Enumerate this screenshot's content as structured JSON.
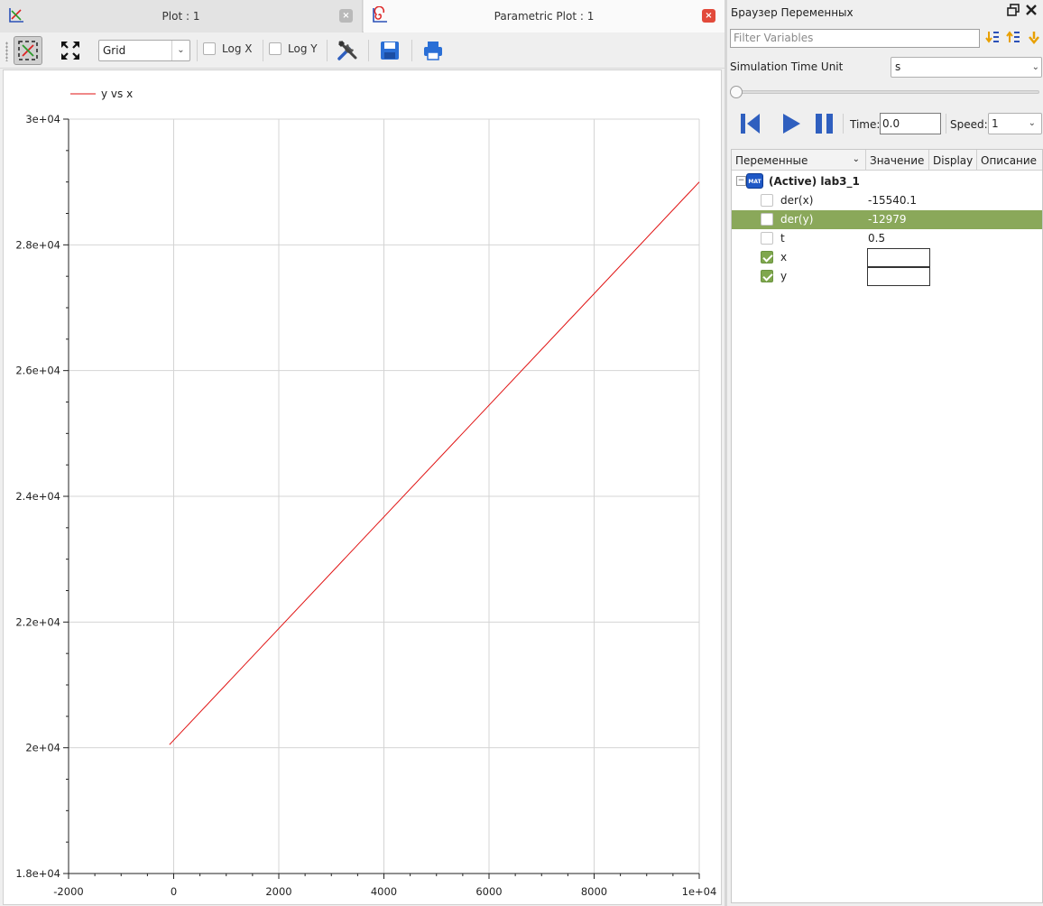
{
  "tabs": [
    {
      "title": "Plot : 1",
      "close": "×"
    },
    {
      "title": "Parametric Plot : 1",
      "close": "×"
    }
  ],
  "toolbar": {
    "grid_select": "Grid",
    "log_x": "Log X",
    "log_y": "Log Y"
  },
  "chart_data": {
    "type": "line",
    "legend": [
      {
        "name": "y vs x",
        "color": "#e01010"
      }
    ],
    "legend_placement": "top-left",
    "x_ticks": [
      "-2000",
      "0",
      "2000",
      "4000",
      "6000",
      "8000",
      "1e+04"
    ],
    "y_ticks": [
      "1.8e+04",
      "2e+04",
      "2.2e+04",
      "2.4e+04",
      "2.6e+04",
      "2.8e+04",
      "3e+04"
    ],
    "xlim": [
      -2000,
      10000
    ],
    "ylim": [
      18000,
      30000
    ],
    "grid": true,
    "series": [
      {
        "name": "y vs x",
        "x": [
          -80,
          10000
        ],
        "y": [
          20050,
          29000
        ]
      }
    ]
  },
  "browser": {
    "title": "Браузер Переменных",
    "filter_placeholder": "Filter Variables",
    "sim_time_unit_label": "Simulation Time Unit",
    "sim_time_unit_value": "s",
    "time_label": "Time:",
    "time_value": "0.0",
    "speed_label": "Speed:",
    "speed_value": "1",
    "columns": [
      "Переменные",
      "Значение",
      "Display",
      "Описание"
    ],
    "root": {
      "icon_text": "MAT",
      "label": "(Active) lab3_1"
    },
    "rows": [
      {
        "name": "der(x)",
        "value": "-15540.1",
        "checked": false,
        "selected": false
      },
      {
        "name": "der(y)",
        "value": "-12979",
        "checked": false,
        "selected": true
      },
      {
        "name": "t",
        "value": "0.5",
        "checked": false,
        "selected": false
      },
      {
        "name": "x",
        "value": "",
        "checked": true,
        "selected": false
      },
      {
        "name": "y",
        "value": "",
        "checked": true,
        "selected": false
      }
    ]
  }
}
